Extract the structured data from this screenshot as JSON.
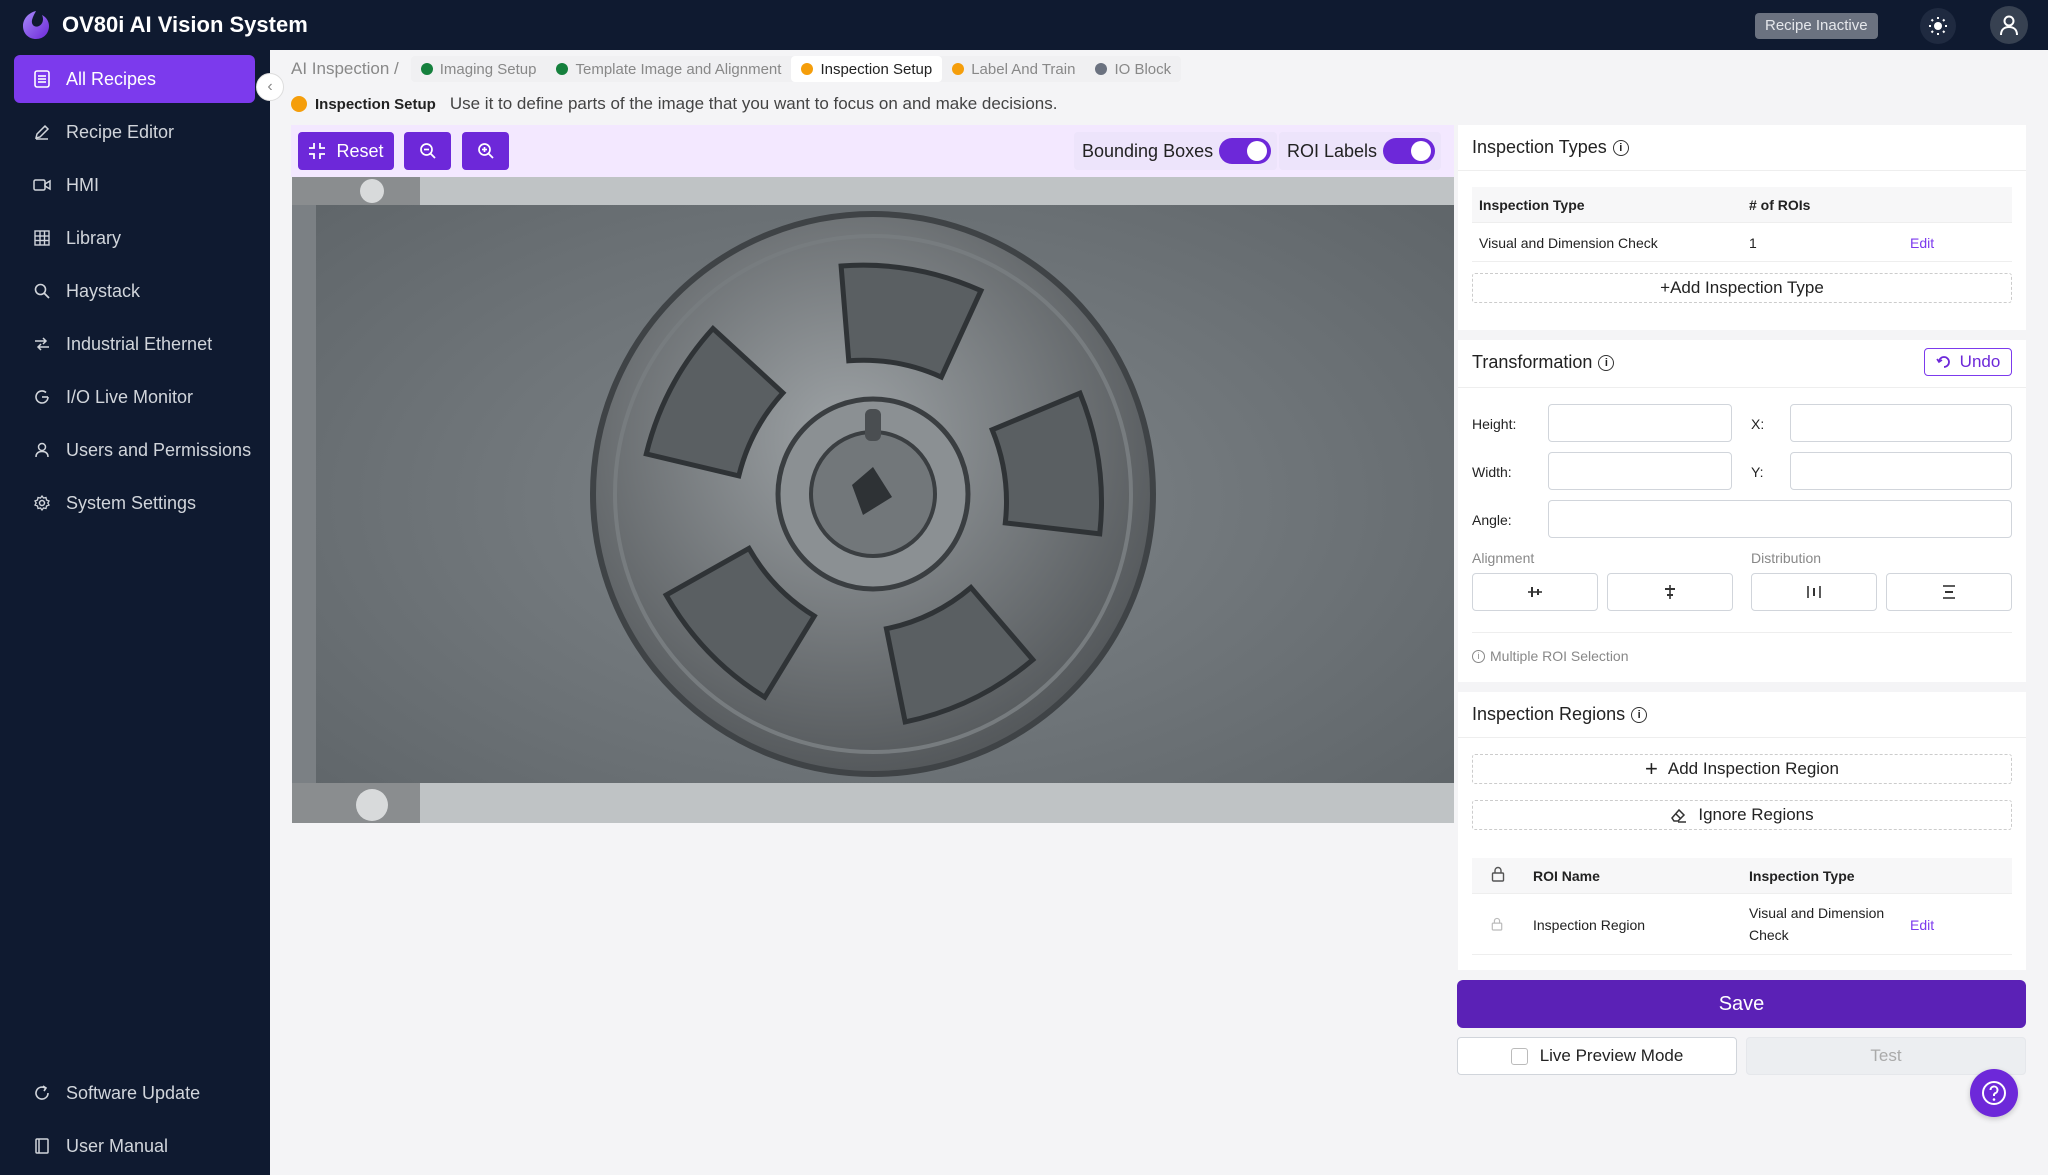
{
  "app": {
    "title": "OV80i AI Vision System",
    "recipe_status": "Recipe Inactive"
  },
  "colors": {
    "accent": "#6d28d9",
    "nav_bg": "#0f1a30",
    "step_done": "#15803d",
    "step_current": "#f59e0b",
    "step_pending": "#6b7280"
  },
  "sidebar": {
    "items": [
      {
        "label": "All Recipes",
        "icon": "recipes-icon",
        "active": true
      },
      {
        "label": "Recipe Editor",
        "icon": "pen-icon"
      },
      {
        "label": "HMI",
        "icon": "camera-icon"
      },
      {
        "label": "Library",
        "icon": "grid-icon"
      },
      {
        "label": "Haystack",
        "icon": "search-icon"
      },
      {
        "label": "Industrial Ethernet",
        "icon": "network-icon"
      },
      {
        "label": "I/O Live Monitor",
        "icon": "monitor-icon"
      },
      {
        "label": "Users and Permissions",
        "icon": "user-icon"
      },
      {
        "label": "System Settings",
        "icon": "gear-icon"
      }
    ],
    "footer": [
      {
        "label": "Software Update",
        "icon": "refresh-icon"
      },
      {
        "label": "User Manual",
        "icon": "book-icon"
      }
    ]
  },
  "breadcrumb": {
    "root": "AI Inspection",
    "separator": "/",
    "steps": [
      {
        "label": "Imaging Setup",
        "status": "done"
      },
      {
        "label": "Template Image and Alignment",
        "status": "done"
      },
      {
        "label": "Inspection Setup",
        "status": "current"
      },
      {
        "label": "Label And Train",
        "status": "pending"
      },
      {
        "label": "IO Block",
        "status": "inactive"
      }
    ]
  },
  "subheader": {
    "title": "Inspection Setup",
    "description": "Use it to define parts of the image that you want to focus on and make decisions."
  },
  "toolbar": {
    "reset_label": "Reset",
    "bounding_boxes_label": "Bounding Boxes",
    "bounding_boxes_on": true,
    "roi_labels_label": "ROI Labels",
    "roi_labels_on": true
  },
  "inspection_types": {
    "title": "Inspection Types",
    "columns": [
      "Inspection Type",
      "# of ROIs"
    ],
    "rows": [
      {
        "type": "Visual and Dimension Check",
        "rois": "1",
        "action": "Edit"
      }
    ],
    "add_label": "+Add Inspection Type"
  },
  "transformation": {
    "title": "Transformation",
    "undo_label": "Undo",
    "height_label": "Height:",
    "width_label": "Width:",
    "x_label": "X:",
    "y_label": "Y:",
    "angle_label": "Angle:",
    "height_value": "",
    "width_value": "",
    "x_value": "",
    "y_value": "",
    "angle_value": "",
    "alignment_label": "Alignment",
    "distribution_label": "Distribution",
    "multi_roi_note": "Multiple ROI Selection"
  },
  "inspection_regions": {
    "title": "Inspection Regions",
    "add_label": "Add Inspection Region",
    "ignore_label": "Ignore Regions",
    "columns": [
      "ROI Name",
      "Inspection Type"
    ],
    "rows": [
      {
        "name": "Inspection Region",
        "type_line1": "Visual and Dimension",
        "type_line2": "Check",
        "action": "Edit"
      }
    ]
  },
  "actions": {
    "save_label": "Save",
    "live_preview_label": "Live Preview Mode",
    "test_label": "Test"
  }
}
